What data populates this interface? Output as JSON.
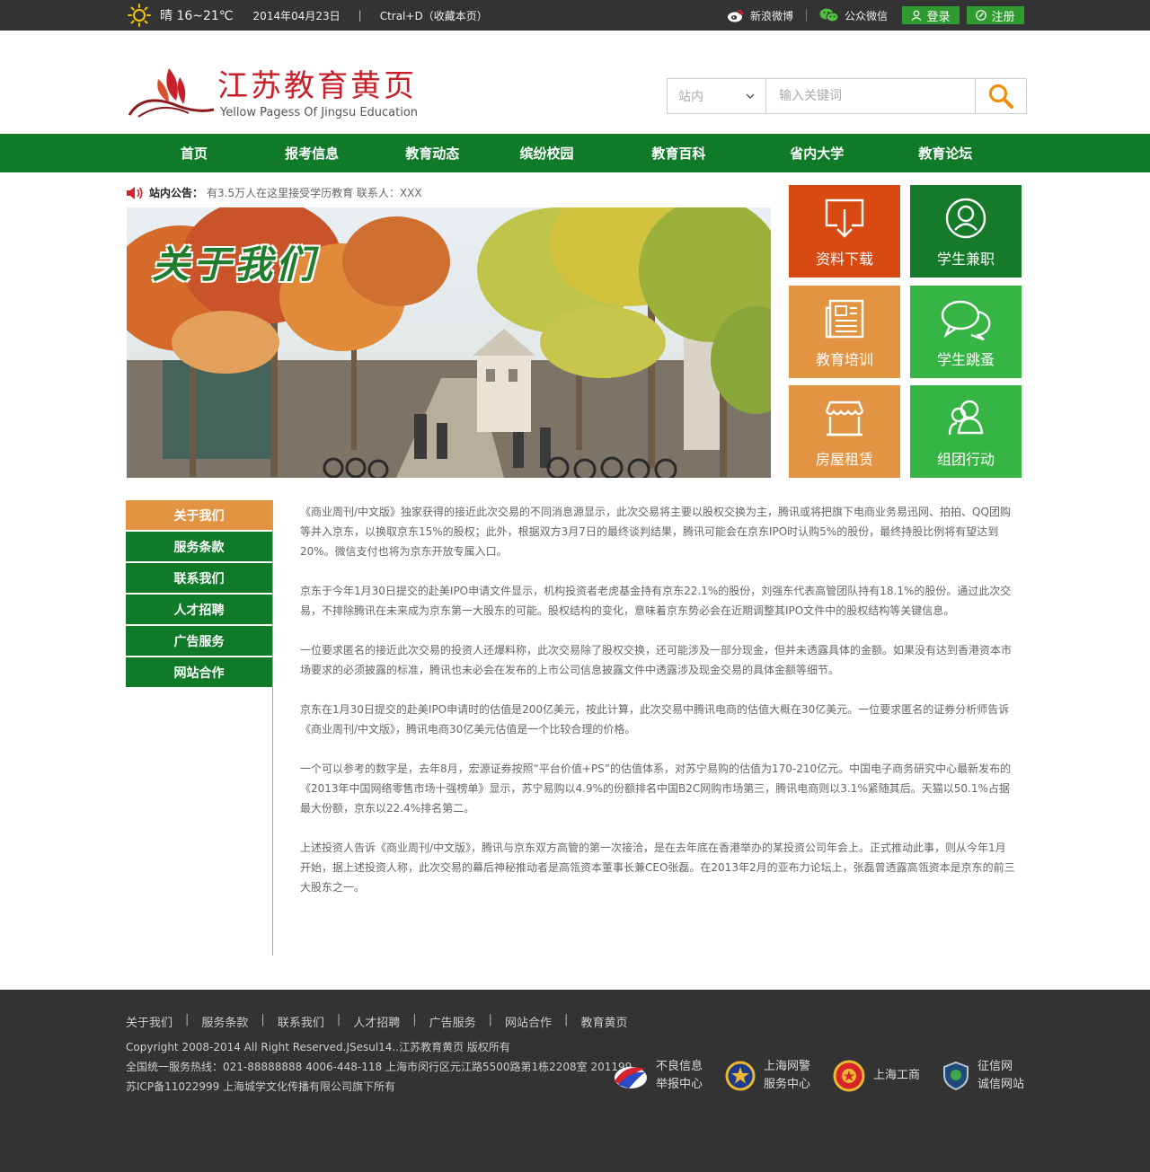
{
  "topbar": {
    "weather": "晴 16~21℃",
    "date": "2014年04月23日",
    "separator": "|",
    "bookmark": "Ctral+D（收藏本页）",
    "weibo": "新浪微博",
    "wechat": "公众微信",
    "login": "登录",
    "register": "注册"
  },
  "header": {
    "logo_title": "江苏教育黄页",
    "logo_subtitle": "Yellow Pagess Of Jingsu Education",
    "search": {
      "scope": "站内",
      "placeholder": "输入关键词"
    }
  },
  "nav": {
    "items": [
      "首页",
      "报考信息",
      "教育动态",
      "缤纷校园",
      "教育百科",
      "省内大学",
      "教育论坛"
    ]
  },
  "notice": {
    "label": "站内公告：",
    "text": "有3.5万人在这里接受学历教育   联系人：XXX"
  },
  "banner": {
    "title": "关于我们"
  },
  "tiles": [
    {
      "label": "资料下载",
      "icon": "download-icon",
      "color": "#d74a12"
    },
    {
      "label": "学生兼职",
      "icon": "user-icon",
      "color": "#157a29"
    },
    {
      "label": "教育培训",
      "icon": "newspaper-icon",
      "color": "#e39442"
    },
    {
      "label": "学生跳蚤",
      "icon": "chat-icon",
      "color": "#37b544"
    },
    {
      "label": "房屋租赁",
      "icon": "store-icon",
      "color": "#e39442"
    },
    {
      "label": "组团行动",
      "icon": "group-icon",
      "color": "#37b544"
    }
  ],
  "sidebar": {
    "items": [
      "关于我们",
      "服务条款",
      "联系我们",
      "人才招聘",
      "广告服务",
      "网站合作"
    ],
    "active": "关于我们"
  },
  "article": {
    "paragraphs": [
      "《商业周刊/中文版》独家获得的接近此次交易的不同消息源显示，此次交易将主要以股权交换为主，腾讯或将把旗下电商业务易迅网、拍拍、QQ团购等并入京东，以换取京东15%的股权；此外，根据双方3月7日的最终谈判结果，腾讯可能会在京东IPO时认购5%的股份，最终持股比例将有望达到20%。微信支付也将为京东开放专属入口。",
      "京东于今年1月30日提交的赴美IPO申请文件显示，机构投资者老虎基金持有京东22.1%的股份，刘强东代表高管团队持有18.1%的股份。通过此次交易，不排除腾讯在未来成为京东第一大股东的可能。股权结构的变化，意味着京东势必会在近期调整其IPO文件中的股权结构等关键信息。",
      "一位要求匿名的接近此次交易的投资人还爆料称，此次交易除了股权交换，还可能涉及一部分现金，但并未透露具体的金额。如果没有达到香港资本市场要求的必须披露的标准，腾讯也未必会在发布的上市公司信息披露文件中透露涉及现金交易的具体金额等细节。",
      "京东在1月30日提交的赴美IPO申请时的估值是200亿美元，按此计算，此次交易中腾讯电商的估值大概在30亿美元。一位要求匿名的证券分析师告诉《商业周刊/中文版》，腾讯电商30亿美元估值是一个比较合理的价格。",
      "一个可以参考的数字是，去年8月，宏源证券按照“平台价值+PS”的估值体系，对苏宁易购的估值为170-210亿元。中国电子商务研究中心最新发布的《2013年中国网络零售市场十强榜单》显示，苏宁易购以4.9%的份额排名中国B2C网购市场第三，腾讯电商则以3.1%紧随其后。天猫以50.1%占据最大份额，京东以22.4%排名第二。",
      "上述投资人告诉《商业周刊/中文版》，腾讯与京东双方高管的第一次接洽，是在去年底在香港举办的某投资公司年会上。正式推动此事，则从今年1月开始，据上述投资人称，此次交易的幕后神秘推动者是高瓴资本董事长兼CEO张磊。在2013年2月的亚布力论坛上，张磊曾透露高瓴资本是京东的前三大股东之一。"
    ]
  },
  "footer": {
    "links": [
      "关于我们",
      "服务条款",
      "联系我们",
      "人才招聘",
      "广告服务",
      "网站合作",
      "教育黄页"
    ],
    "link_separator": "|",
    "copyright": "Copyright 2008-2014 All Right Reserved.JSesul14..江苏教育黄页 版权所有",
    "hotline": "全国统一服务热线：021-88888888 4006-448-118   上海市闵行区元江路5500路第1栋2208室 201199",
    "icp": "苏ICP备11022999   上海城学文化传播有限公司旗下所有",
    "badges": [
      {
        "line1": "不良信息",
        "line2": "举报中心",
        "icon": "report-icon"
      },
      {
        "line1": "上海网警",
        "line2": "服务中心",
        "icon": "police-icon"
      },
      {
        "line1": "上海工商",
        "line2": "",
        "icon": "commerce-icon"
      },
      {
        "line1": "征信网",
        "line2": "诚信网站",
        "icon": "credit-icon"
      }
    ]
  }
}
